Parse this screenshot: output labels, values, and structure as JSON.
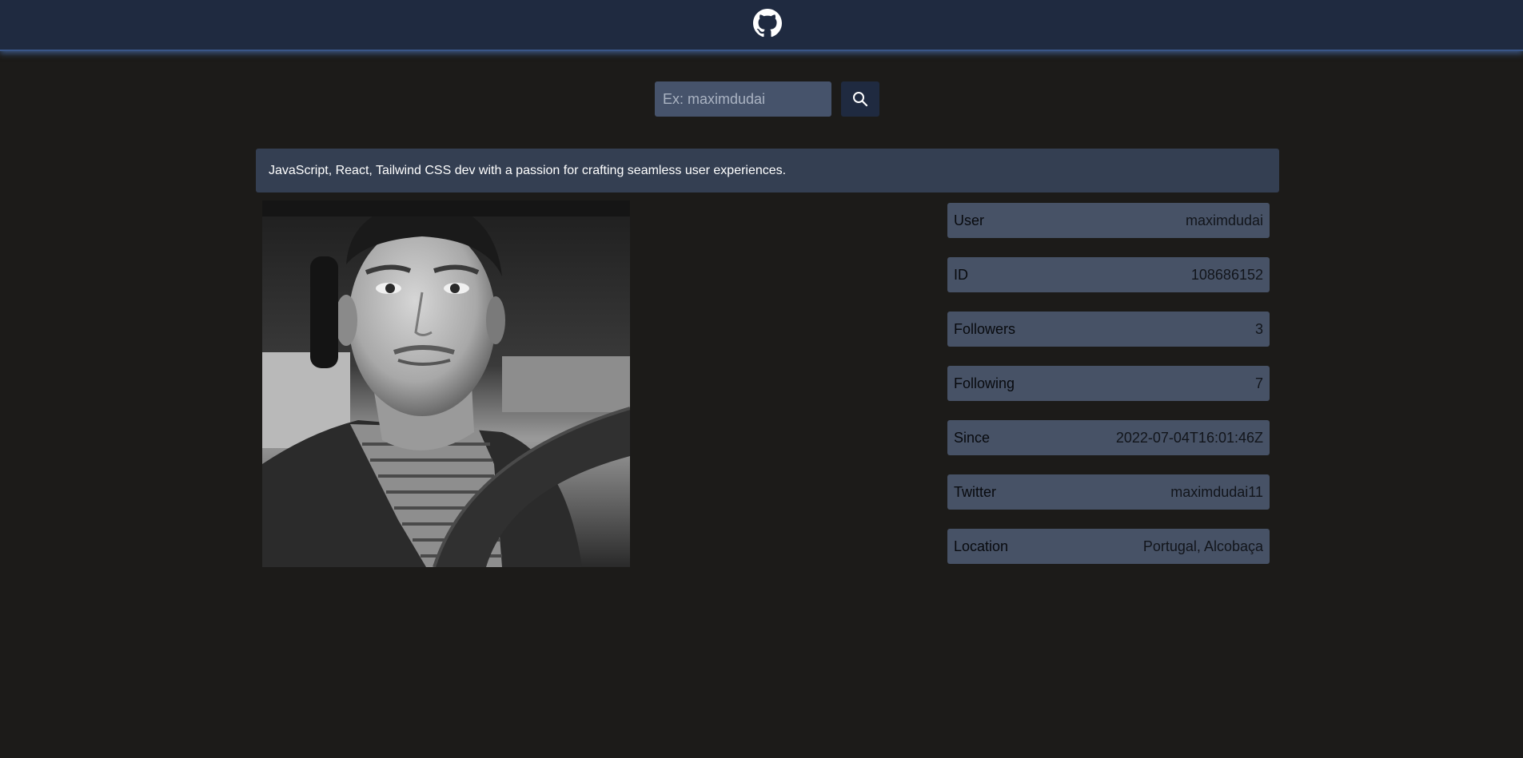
{
  "header": {
    "logo_icon": "github-icon"
  },
  "search": {
    "placeholder": "Ex: maximdudai",
    "value": "",
    "button_icon": "search-icon"
  },
  "profile": {
    "bio": "JavaScript, React, Tailwind CSS dev with a passion for crafting seamless user experiences.",
    "avatar": "avatar-photo",
    "stats": [
      {
        "label": "User",
        "value": "maximdudai"
      },
      {
        "label": "ID",
        "value": "108686152"
      },
      {
        "label": "Followers",
        "value": "3"
      },
      {
        "label": "Following",
        "value": "7"
      },
      {
        "label": "Since",
        "value": "2022-07-04T16:01:46Z"
      },
      {
        "label": "Twitter",
        "value": "maximdudai11"
      },
      {
        "label": "Location",
        "value": "Portugal, Alcobaça"
      }
    ]
  },
  "colors": {
    "page_bg": "#1c1b19",
    "header_bg": "#1f2a40",
    "header_glow": "#5484d2",
    "bio_bg": "#343f52",
    "stat_bg": "#475266",
    "input_bg": "#46536b"
  }
}
